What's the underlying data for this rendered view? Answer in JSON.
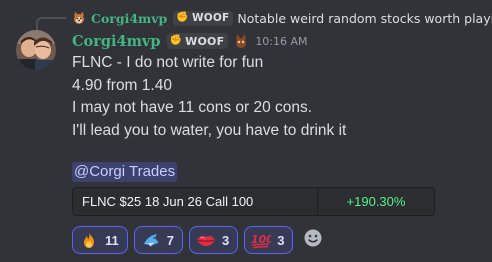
{
  "reply": {
    "username": "Corgi4mvp",
    "tag": "WOOF",
    "text": "Notable weird random stocks worth playing"
  },
  "message": {
    "username": "Corgi4mvp",
    "tag": "WOOF",
    "timestamp": "10:16 AM",
    "lines": [
      "FLNC - I do not write for fun",
      "4.90 from 1.40",
      "I may not have 11 cons or 20 cons.",
      "I'll lead you to water, you have to drink it"
    ],
    "mention": "@Corgi Trades",
    "embed": {
      "contract": "FLNC $25 18 Jun 26 Call 100",
      "change": "+190.30%"
    }
  },
  "reactions": [
    {
      "icon": "fire-icon",
      "count": "11"
    },
    {
      "icon": "shark-icon",
      "count": "7"
    },
    {
      "icon": "lips-icon",
      "count": "3"
    },
    {
      "icon": "hundred-points-icon",
      "count": "3"
    }
  ],
  "add_reaction_icon": "add-reaction-icon",
  "colors": {
    "background": "#313338",
    "username": "#43b581",
    "positive": "#57f287",
    "reaction_border": "#5865f2",
    "mention": "#c9cdfb"
  }
}
